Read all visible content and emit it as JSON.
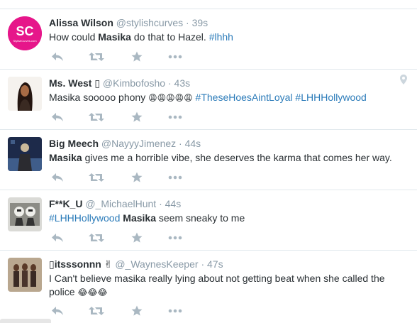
{
  "tweets": [
    {
      "name": "Alissa Wilson",
      "handle": "@stylishcurves",
      "time": "39s",
      "avatar_text": "SC",
      "avatar_sub": "StylishCurves.com",
      "parts": [
        {
          "t": "How could "
        },
        {
          "b": "Masika"
        },
        {
          "t": " do that to Hazel. "
        },
        {
          "h": "#lhhh"
        }
      ]
    },
    {
      "name": "Ms. West ▯",
      "handle": "@Kimbofosho",
      "time": "43s",
      "parts": [
        {
          "t": "Masika sooooo phony "
        },
        {
          "e": "😩😩😩😩😩"
        },
        {
          "t": " "
        },
        {
          "h": "#TheseHoesAintLoyal"
        },
        {
          "t": " "
        },
        {
          "h": "#LHHHollywood"
        }
      ]
    },
    {
      "name": "Big Meech",
      "handle": "@NayyyJimenez",
      "time": "44s",
      "parts": [
        {
          "b": "Masika"
        },
        {
          "t": " gives me a horrible vibe, she deserves the karma that comes her way."
        }
      ]
    },
    {
      "name": "F**K_U",
      "handle": "@_MichaelHunt",
      "time": "44s",
      "parts": [
        {
          "h": "#LHHHollywood"
        },
        {
          "t": " "
        },
        {
          "b": "Masika"
        },
        {
          "t": " seem sneaky to me"
        }
      ]
    },
    {
      "name": "▯itsssonnn ✌",
      "handle": "@_WaynesKeeper",
      "time": "47s",
      "parts": [
        {
          "t": "I Can't believe masika really lying about not getting beat when she called the police "
        },
        {
          "e": "😂😂😂"
        }
      ]
    }
  ],
  "icons": {
    "reply": "reply-icon",
    "retweet": "retweet-icon",
    "favorite": "star-icon",
    "more": "more-icon",
    "location": "location-pin-icon"
  },
  "colors": {
    "hashtag": "#2b7bb9",
    "meta": "#8899a6",
    "action": "#aab8c2",
    "avatar_sc": "#e6168a"
  }
}
